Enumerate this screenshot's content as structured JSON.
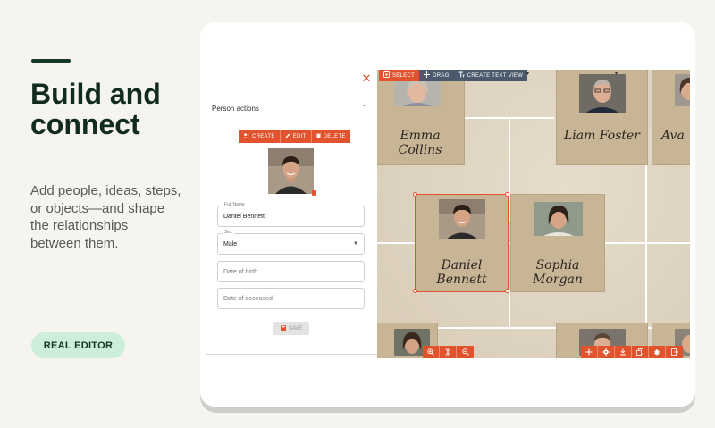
{
  "hero": {
    "title": "Build and connect",
    "description": "Add people, ideas, steps, or objects—and shape the relationships between them.",
    "cta_label": "REAL EDITOR"
  },
  "panel": {
    "section_title": "Person actions",
    "actions": [
      {
        "label": "CREATE",
        "icon": "add-person-icon"
      },
      {
        "label": "EDIT",
        "icon": "pencil-icon"
      },
      {
        "label": "DELETE",
        "icon": "trash-icon"
      }
    ],
    "fields": {
      "full_name_label": "Full Name",
      "full_name_value": "Daniel Bennett",
      "sex_label": "Sex",
      "sex_value": "Male",
      "birth_placeholder": "Date of birth",
      "deceased_placeholder": "Date of deceased"
    },
    "save_label": "SAVE"
  },
  "toolbar": {
    "select_label": "SELECT",
    "drag_label": "DRAG",
    "text_view_label": "CREATE TEXT VIEW",
    "zoom_icons": [
      "zoom-in-icon",
      "fit-icon",
      "zoom-out-icon"
    ],
    "action_icons": [
      "plus-icon",
      "gear-icon",
      "download-icon",
      "copy-icon",
      "bug-icon",
      "export-icon"
    ]
  },
  "tree": {
    "nodes": [
      {
        "name": "Emma Collins"
      },
      {
        "name": "Liam Foster"
      },
      {
        "name": "Ava"
      },
      {
        "name": "Daniel Bennett"
      },
      {
        "name": "Sophia Morgan"
      }
    ]
  },
  "colors": {
    "accent": "#e0532c",
    "dark_green": "#123826",
    "mint": "#cdeedb",
    "node_bg": "#c8b596"
  }
}
